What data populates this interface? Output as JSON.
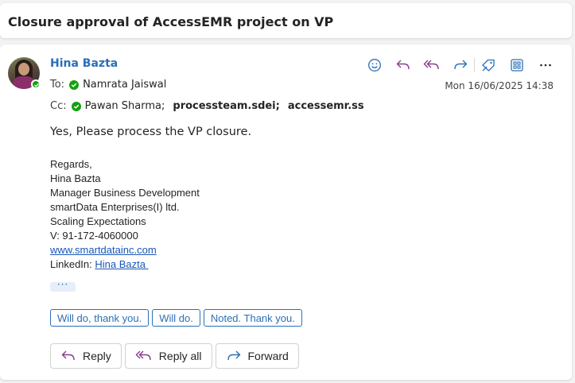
{
  "subject": "Closure approval of AccessEMR project on VP",
  "message": {
    "sender": "Hina Bazta",
    "to_label": "To:",
    "to": "Namrata Jaiswal",
    "cc_label": "Cc:",
    "cc_primary": "Pawan Sharma;",
    "cc_others": [
      "processteam.sdei;",
      "accessemr.ss"
    ],
    "date": "Mon 16/06/2025 14:38",
    "body": "Yes, Please process the VP closure.",
    "signature": {
      "regards": "Regards,",
      "name": "Hina Bazta",
      "title": "Manager Business Development",
      "company": "smartData Enterprises(I) ltd.",
      "tagline": "Scaling Expectations",
      "phone": "V: 91-172-4060000",
      "website": "www.smartdatainc.com",
      "linkedin_label": "LinkedIn:",
      "linkedin_link": "Hina Bazta "
    },
    "more_label": "···"
  },
  "toolbar_icons": [
    "smiley-icon",
    "reply-icon",
    "reply-all-icon",
    "forward-icon",
    "tag-icon",
    "apps-icon",
    "more-icon"
  ],
  "quick_replies": [
    "Will do, thank you.",
    "Will do.",
    "Noted. Thank you."
  ],
  "actions": {
    "reply": "Reply",
    "reply_all": "Reply all",
    "forward": "Forward"
  },
  "colors": {
    "accent": "#2b6fb6",
    "presence": "#13a10e",
    "reply_all_purple": "#8b3a8e"
  }
}
